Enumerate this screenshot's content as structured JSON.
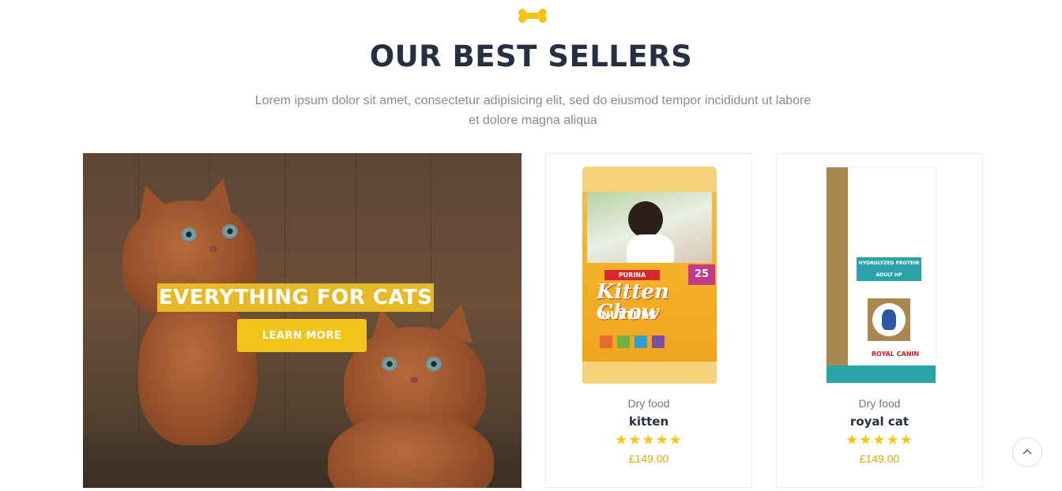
{
  "section": {
    "bone_icon": "bone-icon",
    "title": "OUR BEST SELLERS",
    "subtitle_line1": "Lorem ipsum dolor sit amet, consectetur adipisicing elit, sed do eiusmod tempor incididunt ut labore",
    "subtitle_line2": "et dolore magna aliqua",
    "accent_color": "#f0c419",
    "title_color": "#253043"
  },
  "banner": {
    "heading": "EVERYTHING FOR CATS",
    "button_label": "LEARN MORE"
  },
  "products": [
    {
      "category": "Dry food",
      "name": "kitten",
      "rating_stars": 5,
      "stars": "★★★★★",
      "price": "£149.00",
      "bag_text": {
        "logo": "Kitten Chow",
        "brand": "PURINA",
        "variant": "NURTURE",
        "badge": "25"
      }
    },
    {
      "category": "Dry food",
      "name": "royal cat",
      "rating_stars": 5,
      "stars": "★★★★★",
      "price": "£149.00",
      "bag_text": {
        "label": "HYDROLYZED PROTEIN",
        "sublabel": "ADULT HP",
        "brand": "ROYAL CANIN"
      }
    }
  ],
  "scroll_top": {
    "icon": "chevron-up-icon"
  }
}
